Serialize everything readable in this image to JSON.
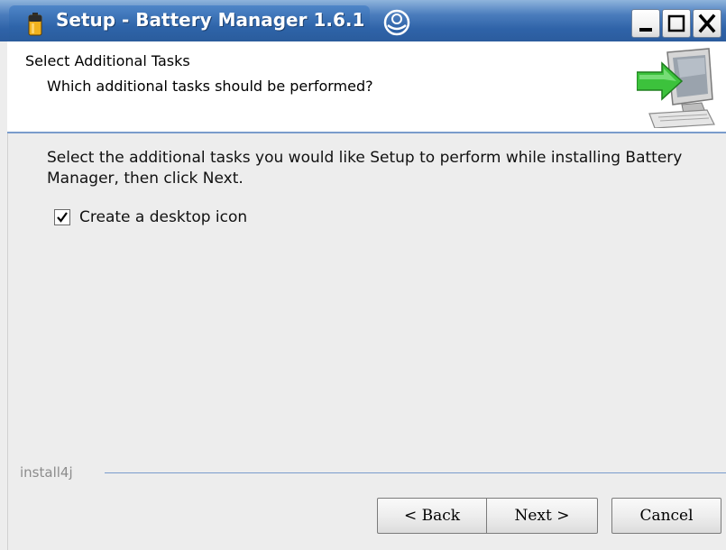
{
  "window": {
    "title": "Setup - Battery Manager 1.6.1",
    "icons": {
      "app": "battery-icon",
      "menu": "window-menu-icon",
      "minimize": "minimize-icon",
      "maximize": "maximize-icon",
      "close": "close-icon"
    }
  },
  "header": {
    "title": "Select Additional Tasks",
    "subtitle": "Which additional tasks should be performed?",
    "art": "computer-install-arrow-icon"
  },
  "body": {
    "description": "Select the additional tasks you would like Setup to perform while installing Battery Manager, then click Next.",
    "tasks": [
      {
        "label": "Create a desktop icon",
        "checked": true
      }
    ]
  },
  "footer": {
    "brand": "install4j",
    "back_label": "< Back",
    "next_label": "Next >",
    "cancel_label": "Cancel"
  },
  "colors": {
    "titlebar": "#2f63a8",
    "accent_line": "#7a9ccc",
    "background": "#ededed",
    "arrow": "#3cc23c"
  }
}
